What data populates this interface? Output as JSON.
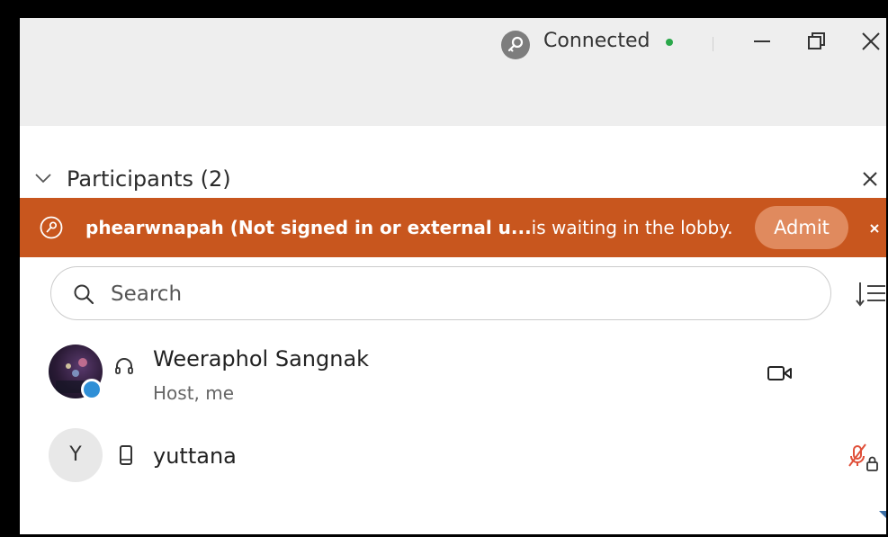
{
  "titlebar": {
    "status_label": "Connected",
    "status_color": "#2aa84a",
    "icons": [
      "connection-key-icon",
      "minimize-icon",
      "restore-icon",
      "close-icon"
    ]
  },
  "panel": {
    "title": "Participants (2)",
    "icons": [
      "chevron-down-icon",
      "close-icon"
    ]
  },
  "lobby_banner": {
    "name_text": "phearwnapah (Not signed in or external u...",
    "message_text": "is waiting in the lobby.",
    "admit_label": "Admit",
    "background": "#c8561e",
    "button_background": "#e08a5e",
    "icons": [
      "key-icon",
      "close-icon"
    ]
  },
  "search": {
    "placeholder": "Search",
    "value": "",
    "icons": [
      "search-icon",
      "sort-icon"
    ]
  },
  "participants": [
    {
      "name": "Weeraphol Sangnak",
      "role": "Host, me",
      "avatar": "photo",
      "device_icon": "headset-icon",
      "status_icon": "video-camera-icon"
    },
    {
      "name": "yuttana",
      "initial": "Y",
      "device_icon": "mobile-phone-icon",
      "status_icon": "muted-locked-microphone-icon",
      "status_color": "#e0503a"
    }
  ]
}
